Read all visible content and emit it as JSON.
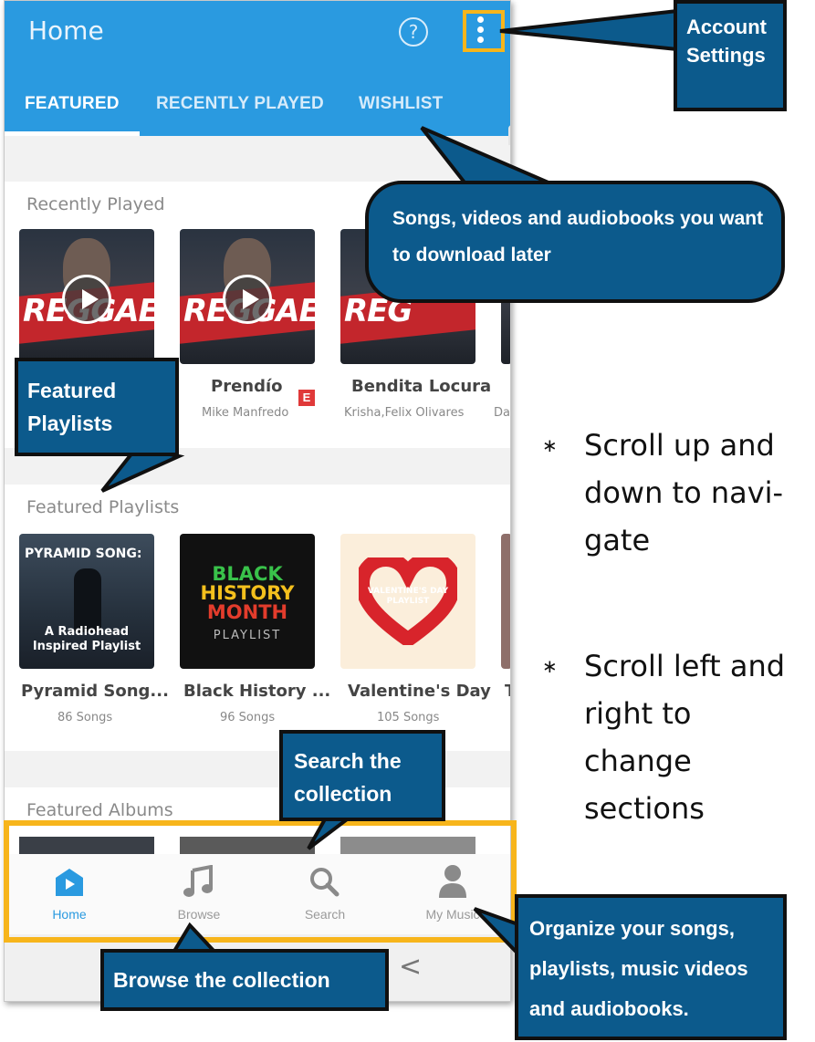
{
  "app": {
    "title": "Home",
    "help_icon": "?",
    "menu_icon": "more-vertical-icon"
  },
  "tabs": [
    {
      "label": "FEATURED",
      "active": true
    },
    {
      "label": "RECENTLY PLAYED",
      "active": false
    },
    {
      "label": "WISHLIST",
      "active": false
    }
  ],
  "recently_played": {
    "title": "Recently Played",
    "items": [
      {
        "art_text": "REG",
        "title": "",
        "artist": ""
      },
      {
        "art_text": "REGGAETON",
        "title": "Prendío",
        "artist": "Mike Manfredo",
        "explicit": "E"
      },
      {
        "art_text": "REGGAETON",
        "title": "Bendita Locura",
        "artist": "Krisha,Felix Olivares"
      },
      {
        "art_text": "",
        "title": "",
        "artist": "Dav"
      }
    ]
  },
  "featured_playlists": {
    "title": "Featured Playlists",
    "items": [
      {
        "art_top": "PYRAMID SONG:",
        "art_bottom": "A Radiohead",
        "art_bottom2": "Inspired Playlist",
        "title": "Pyramid Song...",
        "count": "86 Songs"
      },
      {
        "art_l1": "BLACK",
        "art_l2": "HISTORY",
        "art_l3": "MONTH",
        "art_l4": "PLAYLIST",
        "title": "Black History ...",
        "count": "96 Songs"
      },
      {
        "art_l1": "VALENTINE'S DAY",
        "art_l2": "PLAYLIST",
        "title": "Valentine's Day",
        "count": "105 Songs"
      },
      {
        "title": "T",
        "count": ""
      }
    ]
  },
  "featured_albums": {
    "title": "Featured Albums"
  },
  "bottom_nav": [
    {
      "label": "Home",
      "icon": "home-icon",
      "active": true
    },
    {
      "label": "Browse",
      "icon": "music-note-icon",
      "active": false
    },
    {
      "label": "Search",
      "icon": "search-icon",
      "active": false
    },
    {
      "label": "My Music",
      "icon": "person-icon",
      "active": false
    }
  ],
  "system_nav": {
    "back": "<"
  },
  "annotations": {
    "account_settings": [
      "Account",
      "Settings"
    ],
    "wishlist": [
      "Songs, videos and audiobooks",
      "you want to download later"
    ],
    "featured_playlists": [
      "Featured",
      "Playlists"
    ],
    "search": [
      "Search the",
      "collection"
    ],
    "browse": "Browse the collection",
    "my_music": [
      "Organize your songs,",
      "playlists, music videos",
      "and audiobooks."
    ]
  },
  "instructions": [
    {
      "marker": "∗",
      "lines": [
        "Scroll up and",
        "down to navi-",
        "gate"
      ]
    },
    {
      "marker": "∗",
      "lines": [
        "Scroll left and",
        "right to change",
        "sections"
      ]
    }
  ],
  "colors": {
    "app_bar": "#2a9ae0",
    "callout": "#0c5a8c",
    "highlight": "#f7b51b",
    "explicit": "#e03939"
  }
}
